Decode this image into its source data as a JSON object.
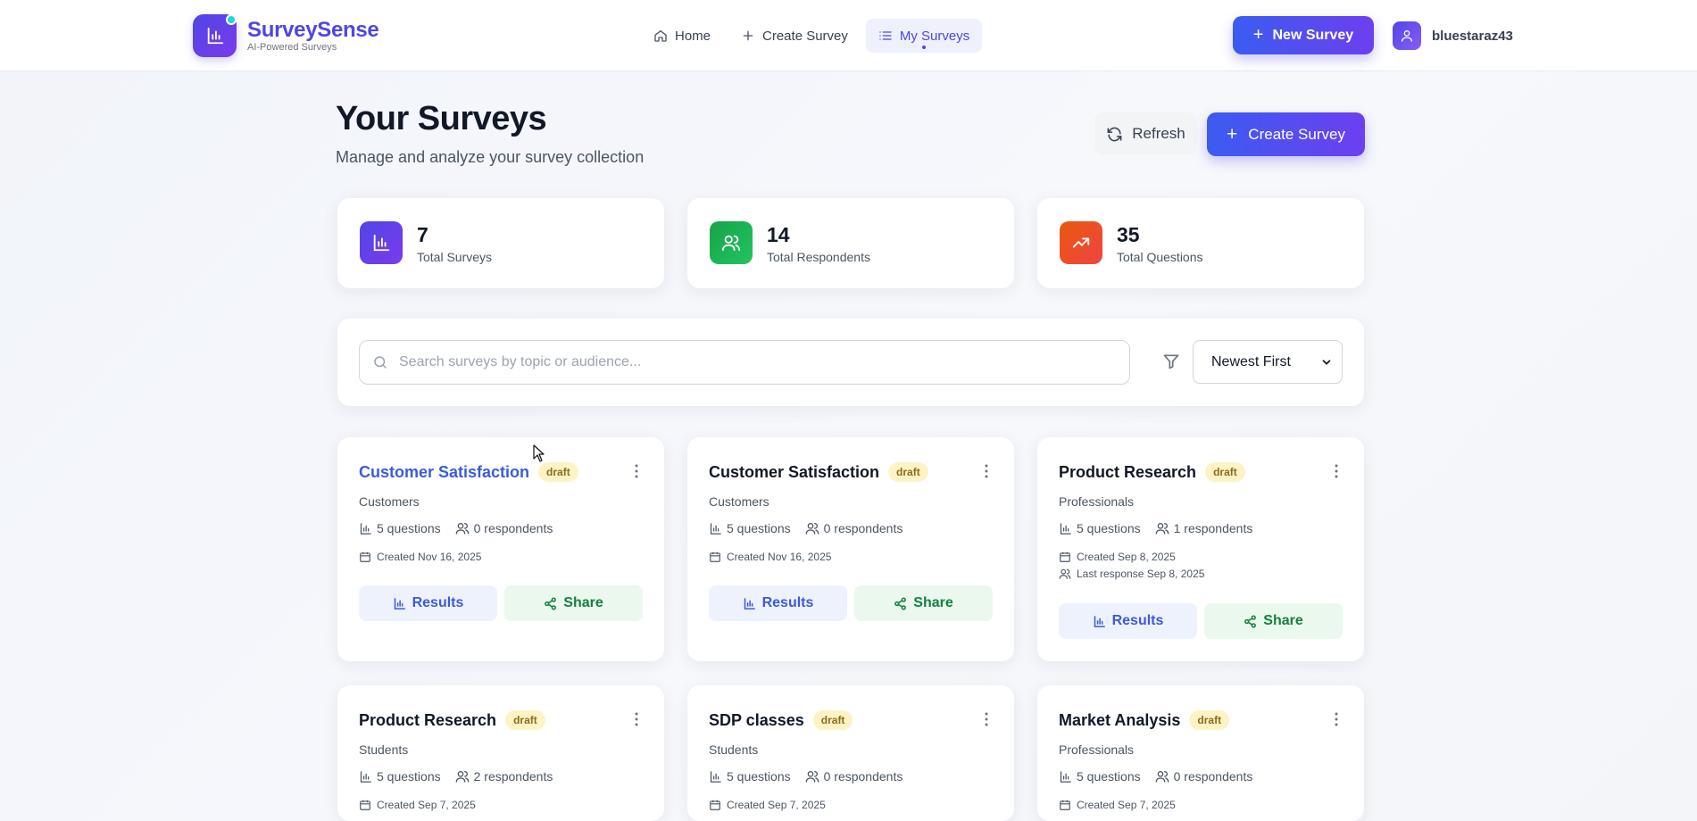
{
  "brand": {
    "name": "SurveySense",
    "tagline": "AI-Powered Surveys",
    "accent": "#4f46e5"
  },
  "nav": {
    "items": [
      {
        "label": "Home",
        "icon": "home-icon"
      },
      {
        "label": "Create Survey",
        "icon": "plus-icon"
      },
      {
        "label": "My Surveys",
        "icon": "list-icon",
        "active": true
      }
    ]
  },
  "header": {
    "new_survey_label": "New Survey",
    "username": "bluestaraz43"
  },
  "page": {
    "title": "Your Surveys",
    "subtitle": "Manage and analyze your survey collection",
    "refresh_label": "Refresh",
    "create_label": "Create Survey"
  },
  "stats": [
    {
      "value": "7",
      "label": "Total Surveys",
      "icon": "bar-chart-icon",
      "color": "#4f46e5"
    },
    {
      "value": "14",
      "label": "Total Respondents",
      "icon": "users-icon",
      "color": "#16a34a"
    },
    {
      "value": "35",
      "label": "Total Questions",
      "icon": "trending-up-icon",
      "color": "#ea580c"
    }
  ],
  "search": {
    "placeholder": "Search surveys by topic or audience...",
    "value": "",
    "sort_selected": "Newest First"
  },
  "surveys": [
    {
      "title": "Customer Satisfaction",
      "status": "draft",
      "audience": "Customers",
      "questions": "5 questions",
      "respondents": "0 respondents",
      "created": "Created Nov 16, 2025",
      "last_response": ""
    },
    {
      "title": "Customer Satisfaction",
      "status": "draft",
      "audience": "Customers",
      "questions": "5 questions",
      "respondents": "0 respondents",
      "created": "Created Nov 16, 2025",
      "last_response": ""
    },
    {
      "title": "Product Research",
      "status": "draft",
      "audience": "Professionals",
      "questions": "5 questions",
      "respondents": "1 respondents",
      "created": "Created Sep 8, 2025",
      "last_response": "Last response Sep 8, 2025"
    },
    {
      "title": "Product Research",
      "status": "draft",
      "audience": "Students",
      "questions": "5 questions",
      "respondents": "2 respondents",
      "created": "Created Sep 7, 2025",
      "last_response": ""
    },
    {
      "title": "SDP classes",
      "status": "draft",
      "audience": "Students",
      "questions": "5 questions",
      "respondents": "0 respondents",
      "created": "Created Sep 7, 2025",
      "last_response": ""
    },
    {
      "title": "Market Analysis",
      "status": "draft",
      "audience": "Professionals",
      "questions": "5 questions",
      "respondents": "0 respondents",
      "created": "Created Sep 7, 2025",
      "last_response": ""
    }
  ],
  "card_actions": {
    "results_label": "Results",
    "share_label": "Share"
  }
}
